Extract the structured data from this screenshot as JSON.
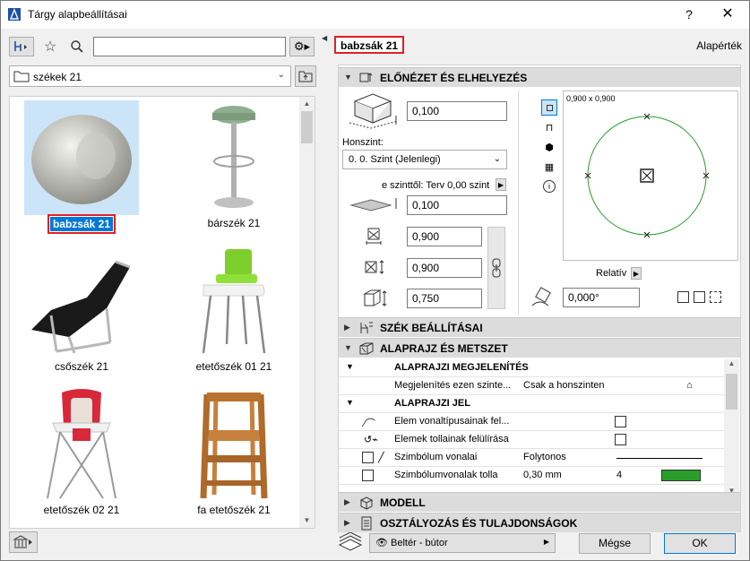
{
  "window": {
    "title": "Tárgy alapbeállításai",
    "help": "?",
    "close": "✕"
  },
  "left": {
    "search_placeholder": "",
    "folder": "székek 21",
    "items": [
      {
        "label": "babzsák 21",
        "selected": true
      },
      {
        "label": "bárszék 21"
      },
      {
        "label": "csőszék 21"
      },
      {
        "label": "etetőszék 01 21"
      },
      {
        "label": "etetőszék 02 21"
      },
      {
        "label": "fa etetőszék 21"
      }
    ]
  },
  "right": {
    "object_name": "babzsák 21",
    "defaults_label": "Alapérték",
    "sections": {
      "preview": "ELŐNÉZET ÉS ELHELYEZÉS",
      "chair": "SZÉK BEÁLLÍTÁSAI",
      "plan": "ALAPRAJZ ÉS METSZET",
      "model": "MODELL",
      "classification": "OSZTÁLYOZÁS ÉS TULAJDONSÁGOK"
    },
    "placement": {
      "elevation_value": "0,100",
      "home_story_label": "Honszint:",
      "home_story_value": "0. 0. Szint (Jelenlegi)",
      "from_story_label": "e szinttől: Terv 0,00 szint",
      "from_story_value": "0,100",
      "width_value": "0,900",
      "depth_value": "0,900",
      "height_value": "0,750",
      "preview_dims": "0,900 x 0,900",
      "relative_label": "Relatív",
      "angle_value": "0,000°"
    },
    "plan_table": {
      "sub1": "ALAPRAJZI MEGJELENÍTÉS",
      "row1_label": "Megjelenítés ezen szinte...",
      "row1_value": "Csak a honszinten",
      "sub2": "ALAPRAJZI JEL",
      "row2_label": "Elem vonaltípusainak fel...",
      "row3_label": "Elemek tollainak felülírása",
      "row4_label": "Szimbólum vonalai",
      "row4_value": "Folytonos",
      "row5_label": "Szimbólumvonalak tolla",
      "row5_value": "0,30 mm",
      "row5_pen": "4"
    },
    "footer": {
      "layer": "Beltér - bútor",
      "cancel": "Mégse",
      "ok": "OK"
    }
  },
  "colors": {
    "accent": "#0078d7",
    "highlight": "#e02020",
    "section_bg": "#dcdcdc",
    "circle": "#2a9d2a"
  }
}
